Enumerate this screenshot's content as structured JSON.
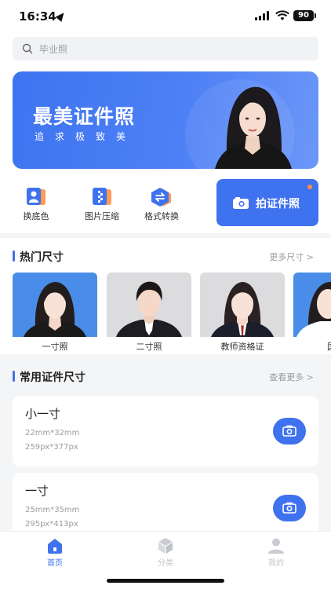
{
  "status_bar": {
    "time": "16:34",
    "battery": "90"
  },
  "search": {
    "placeholder": "毕业照"
  },
  "banner": {
    "title": "最美证件照",
    "subtitle": "追求极致美"
  },
  "tools": [
    {
      "label": "换底色",
      "icon": "id-card-icon"
    },
    {
      "label": "图片压缩",
      "icon": "compress-icon"
    },
    {
      "label": "格式转换",
      "icon": "convert-icon"
    }
  ],
  "shoot_button": {
    "label": "拍证件照",
    "icon": "camera-icon"
  },
  "hot_sizes": {
    "title": "热门尺寸",
    "more": "更多尺寸 >",
    "items": [
      {
        "label": "一寸照"
      },
      {
        "label": "二寸照"
      },
      {
        "label": "教师资格证"
      },
      {
        "label": "国考"
      }
    ]
  },
  "common_sizes": {
    "title": "常用证件尺寸",
    "more": "查看更多 >",
    "items": [
      {
        "name": "小一寸",
        "mm": "22mm*32mm",
        "px": "259px*377px"
      },
      {
        "name": "一寸",
        "mm": "25mm*35mm",
        "px": "295px*413px"
      }
    ]
  },
  "tab_bar": {
    "items": [
      {
        "label": "首页",
        "icon": "home-icon",
        "active": true
      },
      {
        "label": "分类",
        "icon": "category-cube-icon",
        "active": false
      },
      {
        "label": "我的",
        "icon": "profile-icon",
        "active": false
      }
    ]
  },
  "colors": {
    "accent": "#3f72ee",
    "background": "#f4f5f7",
    "muted_text": "#9a9ca3"
  }
}
